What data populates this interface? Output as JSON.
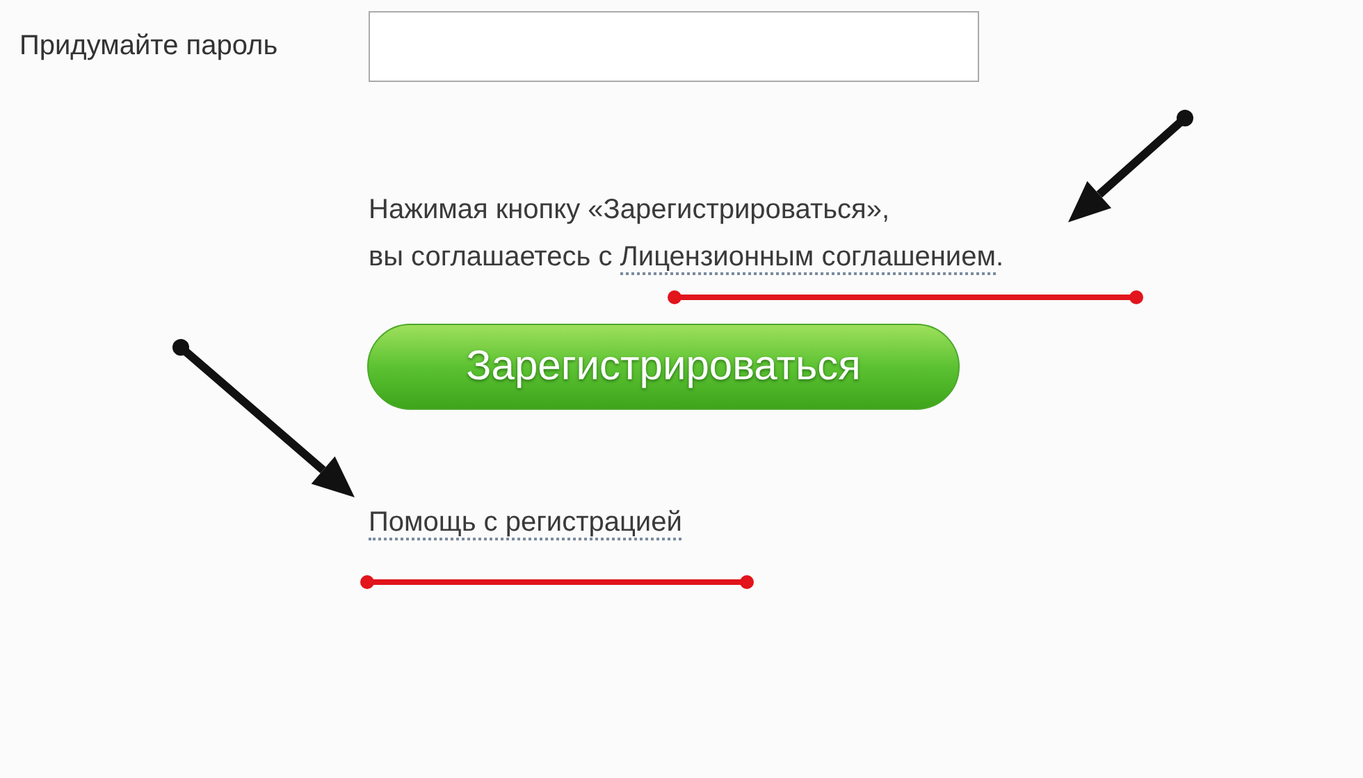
{
  "password_field": {
    "label": "Придумайте пароль"
  },
  "agreement": {
    "line_1": "Нажимая кнопку «Зарегистрироваться»,",
    "before": "вы соглашаетесь с ",
    "link": "Лицензионным соглашением",
    "after": "."
  },
  "register_button": {
    "label": "Зарегистрироваться"
  },
  "help_link": {
    "label": "Помощь с регистрацией"
  },
  "annotations": [
    {
      "kind": "arrow"
    },
    {
      "kind": "underline"
    },
    {
      "kind": "arrow"
    },
    {
      "kind": "underline"
    }
  ]
}
